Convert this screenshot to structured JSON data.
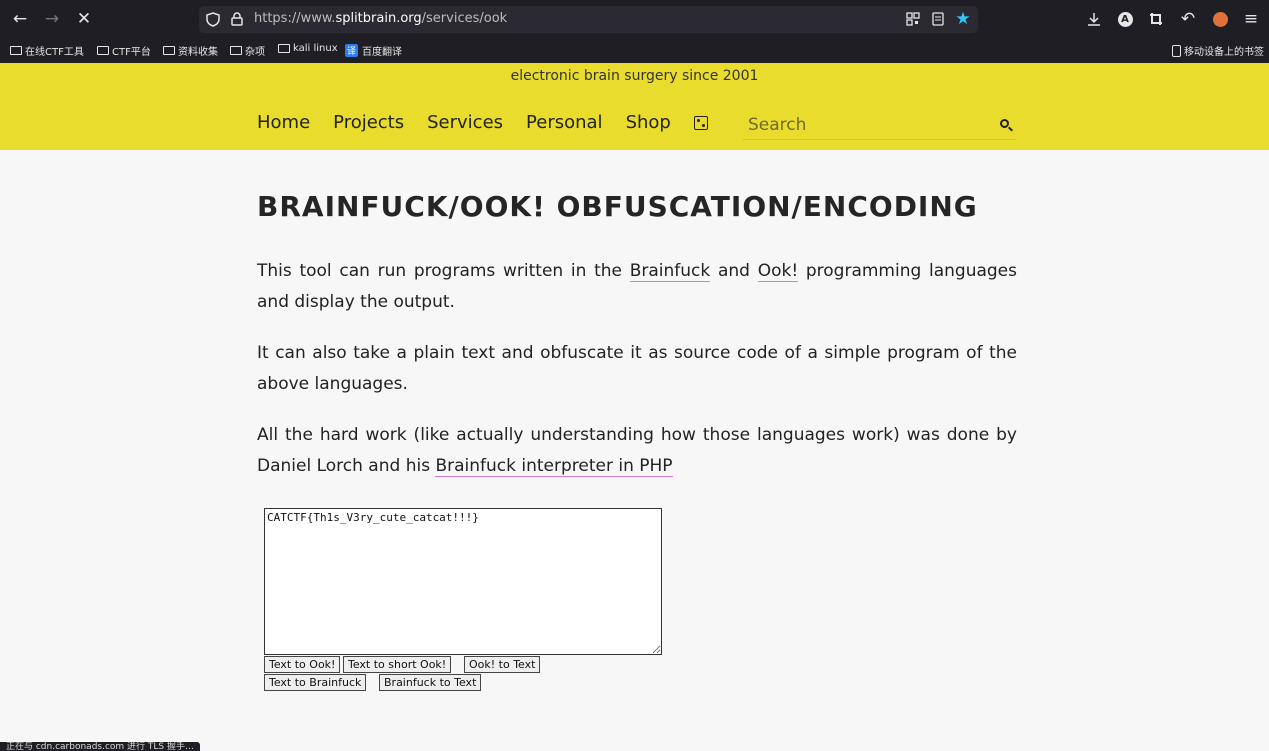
{
  "browser": {
    "url_prefix": "https://www.",
    "url_domain": "splitbrain.org",
    "url_path": "/services/ook",
    "bookmarks": [
      {
        "label": "在线CTF工具"
      },
      {
        "label": "CTF平台"
      },
      {
        "label": "资料收集"
      },
      {
        "label": "杂项"
      },
      {
        "label": "kali linux"
      },
      {
        "label": "百度翻译",
        "badge": "译"
      }
    ],
    "mobile_bookmarks": "移动设备上的书签",
    "status_text": "正在与 cdn.carbonads.com 进行 TLS 握手…"
  },
  "site": {
    "tagline": "electronic brain surgery since 2001",
    "nav": [
      "Home",
      "Projects",
      "Services",
      "Personal",
      "Shop"
    ],
    "search_placeholder": "Search"
  },
  "page": {
    "title": "BRAINFUCK/OOK! OBFUSCATION/ENCODING",
    "p1_a": "This tool can run programs written in the ",
    "p1_link1": "Brainfuck",
    "p1_b": " and ",
    "p1_link2": "Ook!",
    "p1_c": " programming languages and display the output.",
    "p2": "It can also take a plain text and obfuscate it as source code of a simple program of the above languages.",
    "p3_a": "All the hard work (like actually understanding how those languages work) was done by Daniel Lorch and his ",
    "p3_link": "Brainfuck interpreter in PHP",
    "textarea_value": "CATCTF{Th1s_V3ry_cute_catcat!!!}",
    "buttons": [
      "Text to Ook!",
      "Text to short Ook!",
      "Ook! to Text",
      "Text to Brainfuck",
      "Brainfuck to Text"
    ]
  },
  "colors": {
    "header_bg": "#e9dc2c",
    "chrome_bg": "#1f1e25",
    "link_underline": "#d57bd6",
    "bookmark_star": "#2fc5f5"
  }
}
